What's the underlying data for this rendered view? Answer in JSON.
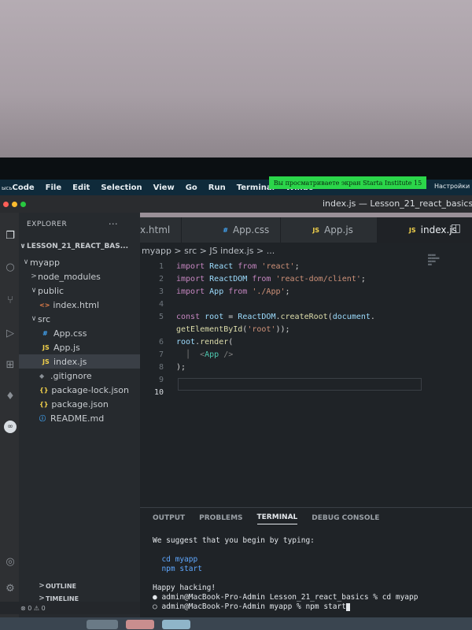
{
  "menu": {
    "app_prefix": "ысь",
    "app": "Code",
    "items": [
      "File",
      "Edit",
      "Selection",
      "View",
      "Go",
      "Run",
      "Terminal",
      "Windo"
    ],
    "banner": "Вы просматриваете экран Starta Institute 15",
    "right": "Настройки н"
  },
  "window": {
    "title": "index.js — Lesson_21_react_basics"
  },
  "colors": {
    "accent": "#2bd64a",
    "editor_bg": "#1f2327",
    "sidebar_bg": "#262a2e"
  },
  "activity_icons": [
    "files-icon",
    "search-icon",
    "source-control-icon",
    "run-debug-icon",
    "extensions-icon",
    "mongodb-icon",
    "chat-icon",
    "account-icon",
    "settings-gear-icon"
  ],
  "explorer": {
    "title": "EXPLORER",
    "more": "···",
    "root": "LESSON_21_REACT_BAS...",
    "items": [
      {
        "label": "myapp",
        "icon": "",
        "chev": "∨"
      },
      {
        "label": "node_modules",
        "icon": "",
        "chev": ">"
      },
      {
        "label": "public",
        "icon": "",
        "chev": "∨"
      },
      {
        "label": "index.html",
        "icon": "<>",
        "chev": ""
      },
      {
        "label": "src",
        "icon": "",
        "chev": "∨"
      },
      {
        "label": "App.css",
        "icon": "#",
        "chev": ""
      },
      {
        "label": "App.js",
        "icon": "JS",
        "chev": ""
      },
      {
        "label": "index.js",
        "icon": "JS",
        "chev": ""
      },
      {
        "label": ".gitignore",
        "icon": "◆",
        "chev": ""
      },
      {
        "label": "package-lock.json",
        "icon": "{}",
        "chev": ""
      },
      {
        "label": "package.json",
        "icon": "{}",
        "chev": ""
      },
      {
        "label": "README.md",
        "icon": "ⓘ",
        "chev": ""
      }
    ],
    "outline": "OUTLINE",
    "timeline": "TIMELINE"
  },
  "tabs": [
    {
      "label": "x.html",
      "icon": ""
    },
    {
      "label": "App.css",
      "icon": "#"
    },
    {
      "label": "App.js",
      "icon": "JS"
    },
    {
      "label": "index.js",
      "icon": "JS"
    }
  ],
  "tab_close": "✕",
  "breadcrumb": "myapp > src > JS index.js > ...",
  "code": [
    {
      "n": "1",
      "parts": [
        [
          "kw",
          "import"
        ],
        [
          "pl",
          " "
        ],
        [
          "id",
          "React"
        ],
        [
          "pl",
          " "
        ],
        [
          "kw",
          "from"
        ],
        [
          "pl",
          " "
        ],
        [
          "str",
          "'react'"
        ],
        [
          "pl",
          ";"
        ]
      ]
    },
    {
      "n": "2",
      "parts": [
        [
          "kw",
          "import"
        ],
        [
          "pl",
          " "
        ],
        [
          "id",
          "ReactDOM"
        ],
        [
          "pl",
          " "
        ],
        [
          "kw",
          "from"
        ],
        [
          "pl",
          " "
        ],
        [
          "str",
          "'react-dom/client'"
        ],
        [
          "pl",
          ";"
        ]
      ]
    },
    {
      "n": "3",
      "parts": [
        [
          "kw",
          "import"
        ],
        [
          "pl",
          " "
        ],
        [
          "id",
          "App"
        ],
        [
          "pl",
          " "
        ],
        [
          "kw",
          "from"
        ],
        [
          "pl",
          " "
        ],
        [
          "str",
          "'./App'"
        ],
        [
          "pl",
          ";"
        ]
      ]
    },
    {
      "n": "4",
      "parts": []
    },
    {
      "n": "5",
      "parts": [
        [
          "kw",
          "const"
        ],
        [
          "pl",
          " "
        ],
        [
          "id",
          "root"
        ],
        [
          "pl",
          " = "
        ],
        [
          "id",
          "ReactDOM"
        ],
        [
          "pl",
          "."
        ],
        [
          "fn",
          "createRoot"
        ],
        [
          "pl",
          "("
        ],
        [
          "id",
          "document"
        ],
        [
          "pl",
          "."
        ]
      ]
    },
    {
      "n": "",
      "parts": [
        [
          "fn",
          "getElementById"
        ],
        [
          "pl",
          "("
        ],
        [
          "str",
          "'root'"
        ],
        [
          "pl",
          "));"
        ]
      ]
    },
    {
      "n": "6",
      "parts": [
        [
          "id",
          "root"
        ],
        [
          "pl",
          "."
        ],
        [
          "fn",
          "render"
        ],
        [
          "pl",
          "("
        ]
      ]
    },
    {
      "n": "7",
      "parts": [
        [
          "pn",
          "  │  "
        ],
        [
          "pn",
          "<"
        ],
        [
          "tag",
          "App"
        ],
        [
          "pl",
          " "
        ],
        [
          "pn",
          "/>"
        ]
      ]
    },
    {
      "n": "8",
      "parts": [
        [
          "pl",
          ");"
        ]
      ]
    },
    {
      "n": "9",
      "parts": []
    },
    {
      "n": "10",
      "parts": []
    }
  ],
  "panel": {
    "tabs": [
      "OUTPUT",
      "PROBLEMS",
      "TERMINAL",
      "DEBUG CONSOLE"
    ],
    "active": "TERMINAL",
    "terminal": [
      {
        "text": "We suggest that you begin by typing:",
        "cls": ""
      },
      {
        "text": "",
        "cls": ""
      },
      {
        "text": "  cd myapp",
        "cls": "blue"
      },
      {
        "text": "  npm start",
        "cls": "blue"
      },
      {
        "text": "",
        "cls": ""
      },
      {
        "text": "Happy hacking!",
        "cls": ""
      },
      {
        "text": "● admin@MacBook-Pro-Admin Lesson_21_react_basics % cd myapp",
        "cls": ""
      },
      {
        "text": "○ admin@MacBook-Pro-Admin myapp % npm start",
        "cls": ""
      }
    ]
  },
  "status": {
    "problems": "⊗ 0 ⚠ 0"
  }
}
